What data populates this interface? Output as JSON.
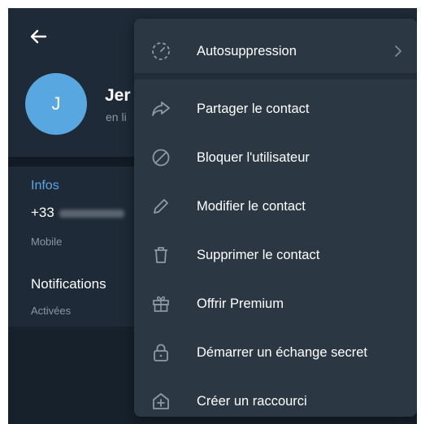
{
  "contact": {
    "avatar_initial": "J",
    "name": "Jer",
    "status": "en li"
  },
  "info": {
    "section_title": "Infos",
    "phone_prefix": "+33",
    "phone_type": "Mobile"
  },
  "notifications": {
    "label": "Notifications",
    "value": "Activées"
  },
  "menu": {
    "items": [
      {
        "label": "Autosuppression",
        "icon": "timer-icon"
      },
      {
        "label": "Partager le contact",
        "icon": "share-icon"
      },
      {
        "label": "Bloquer l'utilisateur",
        "icon": "block-icon"
      },
      {
        "label": "Modifier le contact",
        "icon": "pencil-icon"
      },
      {
        "label": "Supprimer le contact",
        "icon": "trash-icon"
      },
      {
        "label": "Offrir Premium",
        "icon": "gift-icon"
      },
      {
        "label": "Démarrer un échange secret",
        "icon": "lock-icon"
      },
      {
        "label": "Créer un raccourci",
        "icon": "add-shortcut-icon"
      }
    ]
  },
  "colors": {
    "background": "#1e2a37",
    "menu_background": "#2b3743",
    "accent": "#5ea6e4",
    "avatar": "#58a7e0"
  }
}
